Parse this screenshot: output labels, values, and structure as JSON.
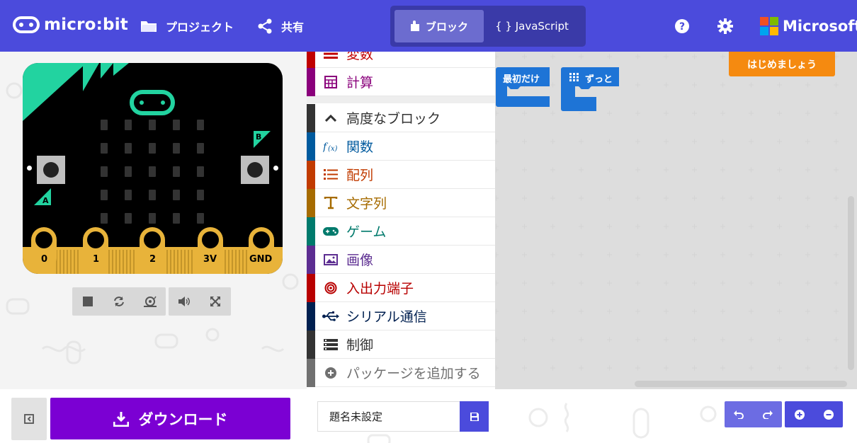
{
  "header": {
    "logo_text": "micro:bit",
    "projects_label": "プロジェクト",
    "share_label": "共有",
    "tab_blocks": "ブロック",
    "tab_javascript": "{ } JavaScript",
    "microsoft_label": "Microsoft",
    "bg_color": "#4b4bdc"
  },
  "simulator": {
    "button_a": "A",
    "button_b": "B",
    "pins": [
      "0",
      "1",
      "2",
      "3V",
      "GND"
    ],
    "controls": [
      "stop-icon",
      "restart-icon",
      "slowmo-icon",
      "mute-icon",
      "fullscreen-icon"
    ]
  },
  "toolbox": {
    "categories": [
      {
        "label": "変数",
        "color": "#c00000",
        "icon": "variable-icon"
      },
      {
        "label": "計算",
        "color": "#8a007b",
        "icon": "calculator-icon"
      },
      {
        "label": "高度なブロック",
        "color": "#333333",
        "icon": "chevron-up-icon"
      },
      {
        "label": "関数",
        "color": "#005a9e",
        "icon": "function-icon"
      },
      {
        "label": "配列",
        "color": "#c13b00",
        "icon": "list-icon"
      },
      {
        "label": "文字列",
        "color": "#a66b00",
        "icon": "text-icon"
      },
      {
        "label": "ゲーム",
        "color": "#007a6c",
        "icon": "gamepad-icon"
      },
      {
        "label": "画像",
        "color": "#5c2d91",
        "icon": "image-icon"
      },
      {
        "label": "入出力端子",
        "color": "#b80000",
        "icon": "pins-icon"
      },
      {
        "label": "シリアル通信",
        "color": "#002050",
        "icon": "usb-icon"
      },
      {
        "label": "制御",
        "color": "#333333",
        "icon": "control-icon"
      },
      {
        "label": "パッケージを追加する",
        "color": "#707070",
        "icon": "add-icon"
      }
    ]
  },
  "workspace": {
    "block_on_start": "最初だけ",
    "block_forever": "ずっと",
    "getting_started": "はじめましょう"
  },
  "footer": {
    "download_label": "ダウンロード",
    "project_name_value": "題名未設定"
  }
}
